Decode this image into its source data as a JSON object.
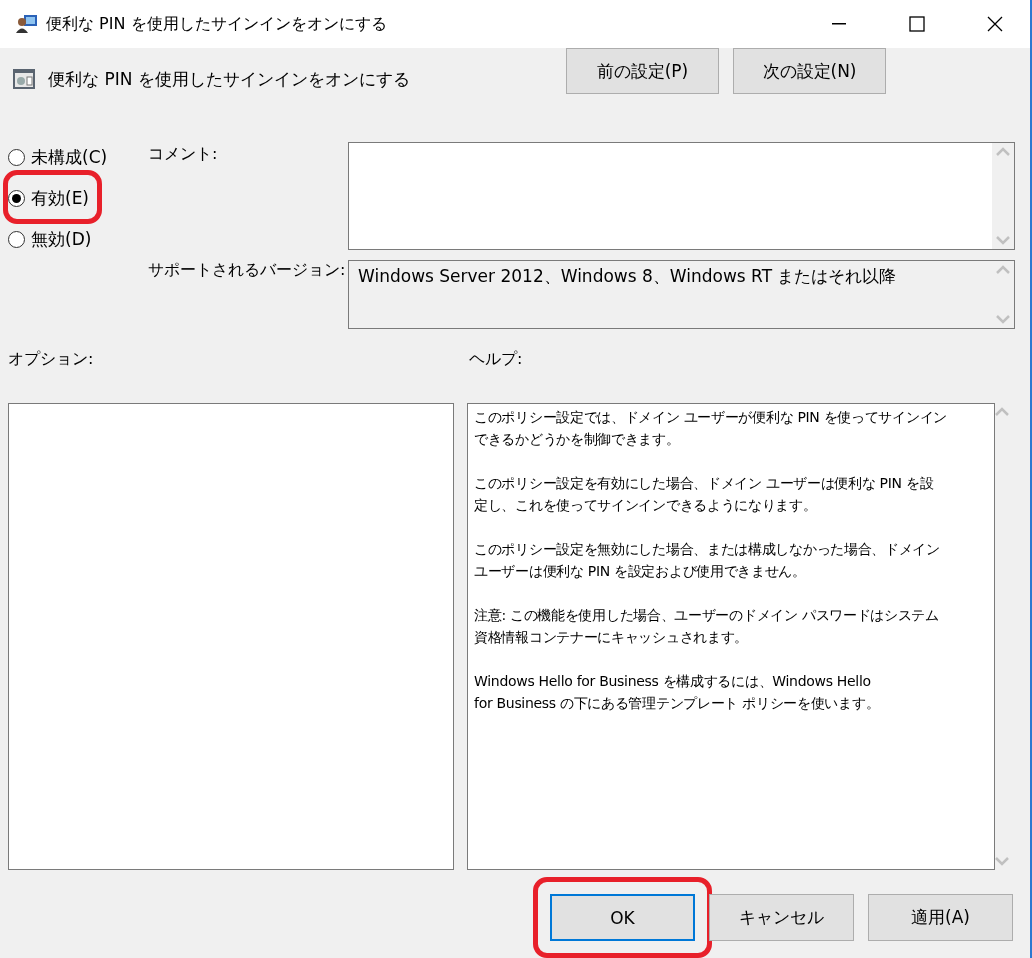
{
  "window": {
    "title": "便利な PIN を使用したサインインをオンにする"
  },
  "policy": {
    "heading": "便利な PIN を使用したサインインをオンにする"
  },
  "nav_buttons": [
    {
      "label": "前の設定(P)"
    },
    {
      "label": "次の設定(N)"
    }
  ],
  "state_options": [
    {
      "label": "未構成(C)",
      "selected": false,
      "highlighted": false
    },
    {
      "label": "有効(E)",
      "selected": true,
      "highlighted": true
    },
    {
      "label": "無効(D)",
      "selected": false,
      "highlighted": false
    }
  ],
  "comment": {
    "label": "コメント:"
  },
  "supported": {
    "label": "サポートされるバージョン:",
    "value": "Windows Server 2012、Windows 8、Windows RT またはそれ以降"
  },
  "options": {
    "label": "オプション:"
  },
  "help": {
    "label": "ヘルプ:",
    "paragraphs": [
      [
        "このポリシー設定では、ドメイン ユーザーが便利な PIN を使ってサインイン",
        "できるかどうかを制御できます。"
      ],
      [
        "このポリシー設定を有効にした場合、ドメイン ユーザーは便利な PIN を設",
        "定し、これを使ってサインインできるようになります。"
      ],
      [
        "このポリシー設定を無効にした場合、または構成しなかった場合、ドメイン",
        "ユーザーは便利な PIN を設定および使用できません。"
      ],
      [
        "注意: この機能を使用した場合、ユーザーのドメイン パスワードはシステム",
        "資格情報コンテナーにキャッシュされます。"
      ],
      [
        "Windows Hello for Business を構成するには、Windows Hello",
        "for Business の下にある管理テンプレート ポリシーを使います。"
      ]
    ]
  },
  "buttons": [
    {
      "label": "OK",
      "default": true,
      "highlighted": true
    },
    {
      "label": "キャンセル",
      "default": false,
      "highlighted": false
    },
    {
      "label": "適用(A)",
      "default": false,
      "highlighted": false
    }
  ]
}
